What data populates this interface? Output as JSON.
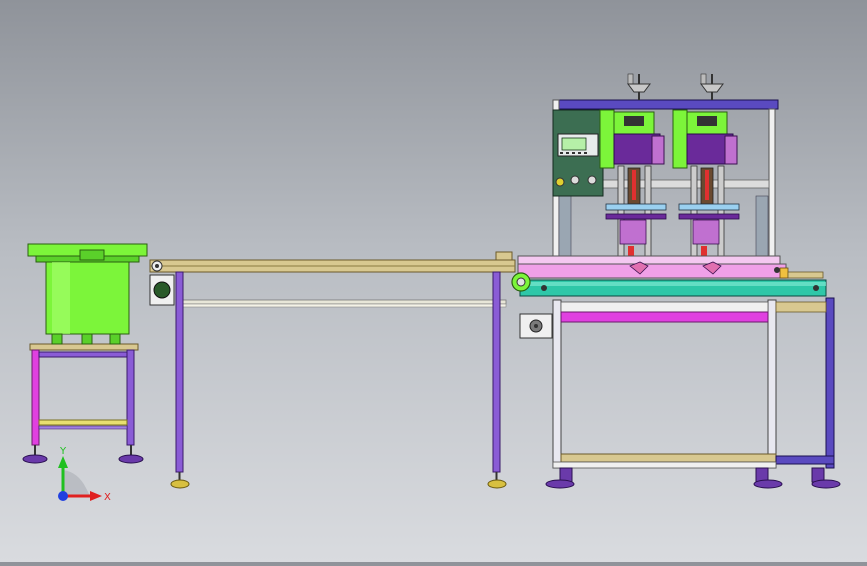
{
  "viewport": {
    "background_top": "#8f939a",
    "background_bottom": "#d9dbdf"
  },
  "machine": {
    "bowl_color": "#7cf53a",
    "frame_purple": "#8a5cd6",
    "frame_magenta": "#e040e0",
    "rail_tan": "#d8c890",
    "head_purple": "#6a2a9a",
    "table_teal": "#2ec7a8",
    "panel_green": "#3c6e52",
    "lcd_green": "#b6f0a8"
  },
  "triad": {
    "x_label": "X",
    "y_label": "Y",
    "x_color": "#e02020",
    "y_color": "#20c020",
    "z_color": "#2040e0"
  }
}
